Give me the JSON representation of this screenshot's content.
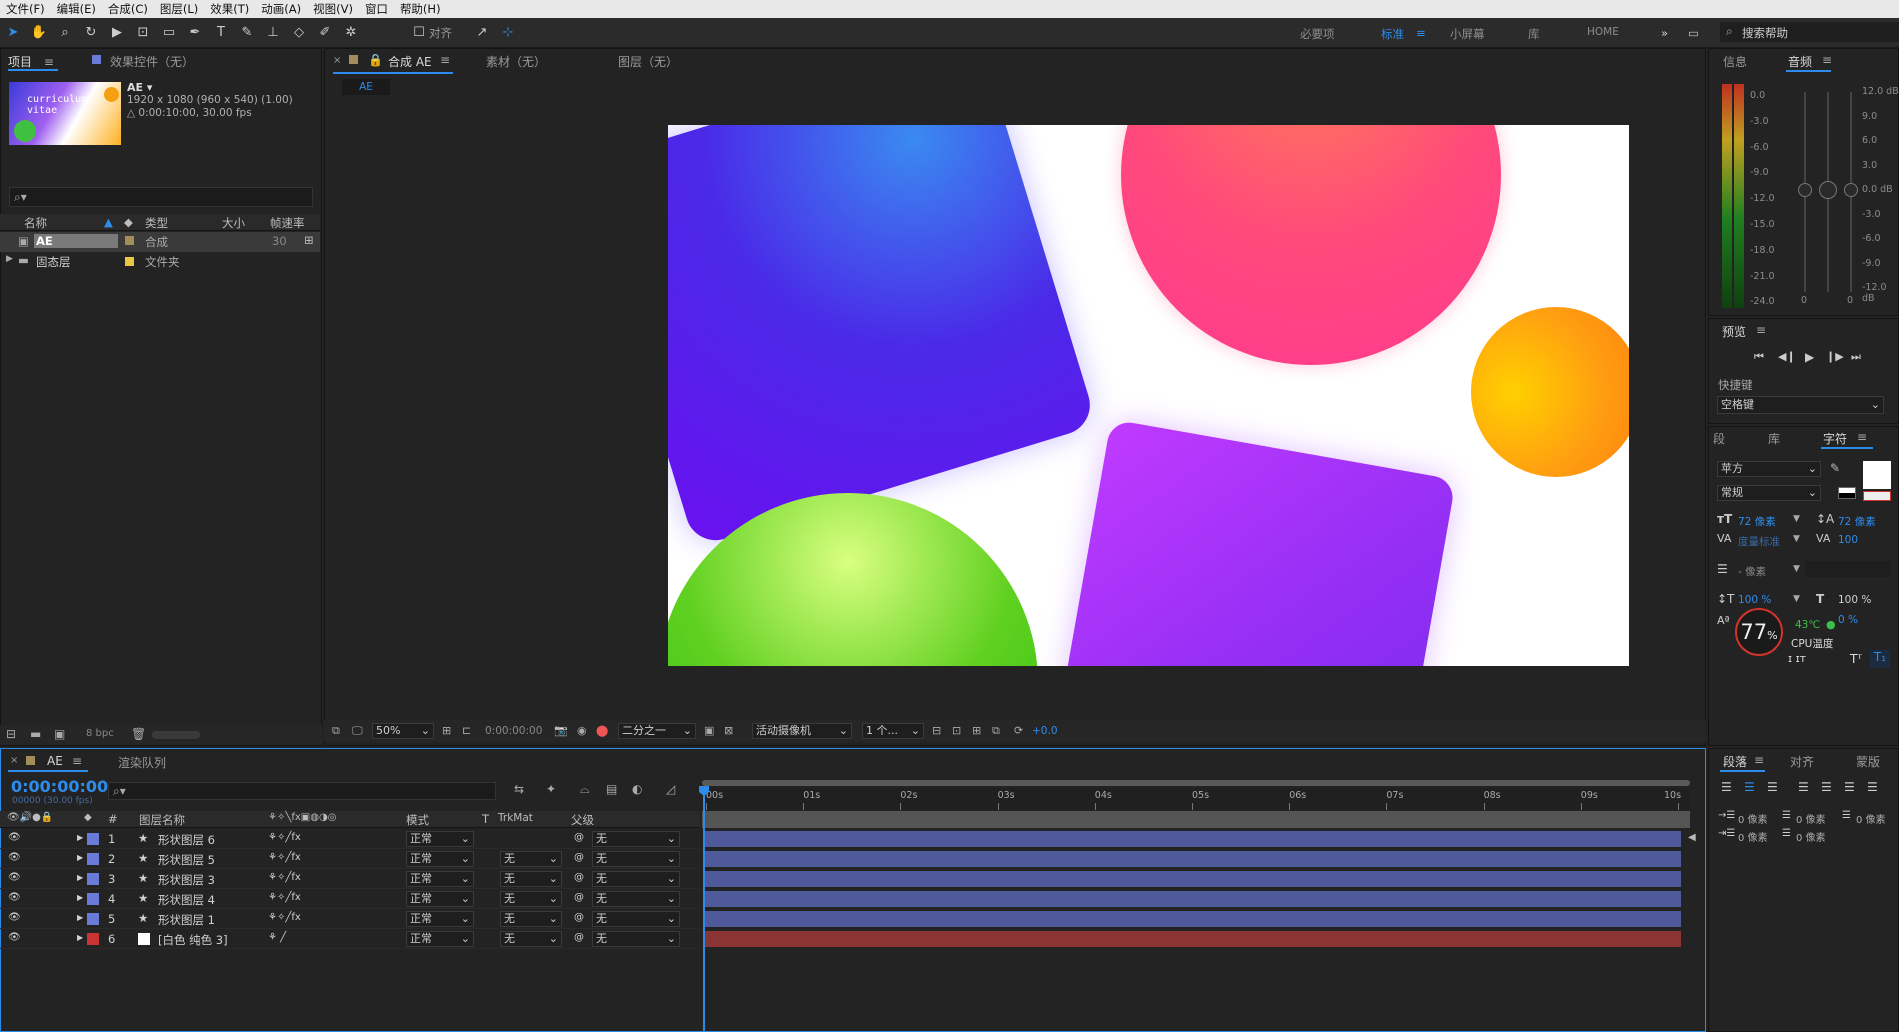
{
  "menu": [
    "文件(F)",
    "编辑(E)",
    "合成(C)",
    "图层(L)",
    "效果(T)",
    "动画(A)",
    "视图(V)",
    "窗口",
    "帮助(H)"
  ],
  "toolbar": {
    "align_label": "对齐",
    "workspaces": [
      "必要项",
      "标准",
      "小屏幕",
      "库",
      "HOME"
    ],
    "search_help": "搜索帮助"
  },
  "project": {
    "tab": "项目",
    "effects_tab": "效果控件（无）",
    "comp_name": "AE ▾",
    "comp_info1": "1920 x 1080  (960 x 540) (1.00)",
    "comp_info2": "△ 0:00:10:00, 30.00 fps",
    "thumb_text1": "curriculum",
    "thumb_text2": "vitae",
    "search_icon": "⌕▾",
    "cols": [
      "名称",
      "类型",
      "大小",
      "帧速率"
    ],
    "items": [
      {
        "name": "AE",
        "type": "合成",
        "size": "",
        "fps": "30",
        "color": "#a38d5a"
      },
      {
        "name": "固态层",
        "type": "文件夹",
        "size": "",
        "fps": "",
        "color": "#e8c840"
      }
    ],
    "bpc": "8 bpc"
  },
  "viewer": {
    "tab_comp": "合成 AE",
    "tab_footage": "素材（无）",
    "tab_layer": "图层（无）",
    "sub_tab": "AE",
    "zoom": "50%",
    "time": "0:00:00:00",
    "resolution": "二分之一",
    "camera": "活动摄像机",
    "views": "1 个...",
    "exposure": "+0.0"
  },
  "info_panel": {
    "tab_info": "信息",
    "tab_audio": "音频",
    "left_scale": [
      "0.0",
      "-3.0",
      "-6.0",
      "-9.0",
      "-12.0",
      "-15.0",
      "-18.0",
      "-21.0",
      "-24.0"
    ],
    "right_scale": [
      "12.0 dB",
      "9.0",
      "6.0",
      "3.0",
      "0.0 dB",
      "-3.0",
      "-6.0",
      "-9.0",
      "-12.0 dB"
    ],
    "zero_left": "0",
    "zero_right": "0"
  },
  "preview": {
    "title": "预览",
    "shortcut_label": "快捷键",
    "shortcut_value": "空格键"
  },
  "character": {
    "tab1": "段",
    "tab2": "库",
    "tab3": "字符",
    "font": "苹方",
    "style": "常规",
    "size": "72 像素",
    "leading": "72 像素",
    "kerning": "度量标准",
    "tracking": "100",
    "stroke": "- 像素",
    "vscale": "100 %",
    "hscale": "100 %",
    "baseline": "0 %"
  },
  "cpu": {
    "usage": "77",
    "unit": "%",
    "temp": "43℃",
    "label": "CPU温度"
  },
  "paragraph": {
    "tab1": "段落",
    "tab2": "对齐",
    "tab3": "蒙版",
    "indent1": "0 像素",
    "indent2": "0 像素",
    "indent3": "0 像素",
    "indent4": "0 像素",
    "indent5": "0 像素"
  },
  "timeline": {
    "tab": "AE",
    "render_tab": "渲染队列",
    "timecode": "0:00:00:00",
    "frame_info": "00000 (30.00 fps)",
    "cols": {
      "name": "图层名称",
      "mode": "模式",
      "t": "T",
      "trkmat": "TrkMat",
      "parent": "父级"
    },
    "ruler": [
      "00s",
      "01s",
      "02s",
      "03s",
      "04s",
      "05s",
      "06s",
      "07s",
      "08s",
      "09s",
      "10s"
    ],
    "layers": [
      {
        "num": "1",
        "name": "形状图层 6",
        "mode": "正常",
        "trk": "",
        "parent": "无",
        "color": "#6a7ad8"
      },
      {
        "num": "2",
        "name": "形状图层 5",
        "mode": "正常",
        "trk": "无",
        "parent": "无",
        "color": "#6a7ad8"
      },
      {
        "num": "3",
        "name": "形状图层 3",
        "mode": "正常",
        "trk": "无",
        "parent": "无",
        "color": "#6a7ad8"
      },
      {
        "num": "4",
        "name": "形状图层 4",
        "mode": "正常",
        "trk": "无",
        "parent": "无",
        "color": "#6a7ad8"
      },
      {
        "num": "5",
        "name": "形状图层 1",
        "mode": "正常",
        "trk": "无",
        "parent": "无",
        "color": "#6a7ad8"
      },
      {
        "num": "6",
        "name": "[白色 纯色 3]",
        "mode": "正常",
        "trk": "无",
        "parent": "无",
        "color": "#c83434"
      }
    ]
  }
}
